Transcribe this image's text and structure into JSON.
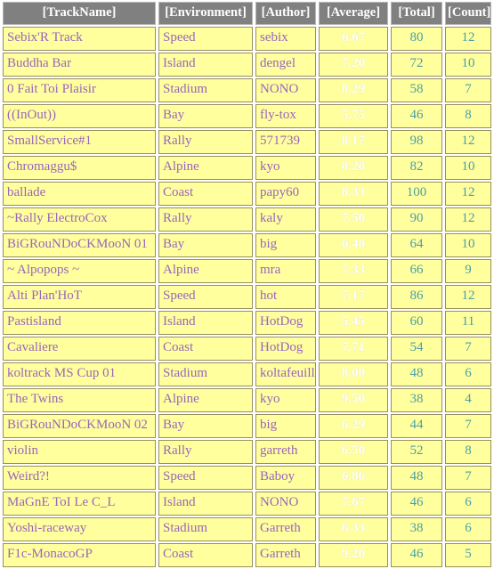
{
  "table": {
    "columns": [
      {
        "key": "track_name",
        "label": "[TrackName]",
        "cls": "c-name"
      },
      {
        "key": "environment",
        "label": "[Environment]",
        "cls": "c-env"
      },
      {
        "key": "author",
        "label": "[Author]",
        "cls": "c-author"
      },
      {
        "key": "average",
        "label": "[Average]",
        "cls": "c-avg"
      },
      {
        "key": "total",
        "label": "[Total]",
        "cls": "c-total"
      },
      {
        "key": "count",
        "label": "[Count]",
        "cls": "c-count"
      }
    ],
    "colors": {
      "header_bg": "#808080",
      "header_text": "#ffffff",
      "cell_bg": "#ffff9e",
      "cell_border": "#998f5c",
      "text_violet": "#9966bb",
      "text_teal": "#4a9fa8",
      "average_good": "#00dd00",
      "average_warn": "#f08000",
      "average_text": "#ffffff"
    },
    "rows": [
      {
        "track_name": "Sebix'R Track",
        "environment": "Speed",
        "author": "sebix",
        "average": "6.67",
        "avg_state": "good",
        "total": "80",
        "count": "12"
      },
      {
        "track_name": "Buddha Bar",
        "environment": "Island",
        "author": "dengel",
        "average": "7.20",
        "avg_state": "good",
        "total": "72",
        "count": "10"
      },
      {
        "track_name": "0 Fait Toi Plaisir",
        "environment": "Stadium",
        "author": "NONO",
        "average": "8.29",
        "avg_state": "good",
        "total": "58",
        "count": "7"
      },
      {
        "track_name": "((InOut))",
        "environment": "Bay",
        "author": "fly-tox",
        "average": "5.75",
        "avg_state": "warn",
        "total": "46",
        "count": "8"
      },
      {
        "track_name": "SmallService#1",
        "environment": "Rally",
        "author": "571739",
        "average": "8.17",
        "avg_state": "good",
        "total": "98",
        "count": "12"
      },
      {
        "track_name": "Chromaggu$",
        "environment": "Alpine",
        "author": "kyo",
        "average": "8.20",
        "avg_state": "good",
        "total": "82",
        "count": "10"
      },
      {
        "track_name": "ballade",
        "environment": "Coast",
        "author": "papy60",
        "average": "8.33",
        "avg_state": "good",
        "total": "100",
        "count": "12"
      },
      {
        "track_name": "~Rally ElectroCox",
        "environment": "Rally",
        "author": "kaly",
        "average": "7.50",
        "avg_state": "good",
        "total": "90",
        "count": "12"
      },
      {
        "track_name": "BiGRouNDoCKMooN 01",
        "environment": "Bay",
        "author": "big",
        "average": "6.40",
        "avg_state": "good",
        "total": "64",
        "count": "10"
      },
      {
        "track_name": "~ Alpopops ~",
        "environment": "Alpine",
        "author": "mra",
        "average": "7.33",
        "avg_state": "good",
        "total": "66",
        "count": "9"
      },
      {
        "track_name": "Alti Plan'HoT",
        "environment": "Speed",
        "author": "hot",
        "average": "7.17",
        "avg_state": "good",
        "total": "86",
        "count": "12"
      },
      {
        "track_name": "Pastisland",
        "environment": "Island",
        "author": "HotDog",
        "average": "5.45",
        "avg_state": "warn",
        "total": "60",
        "count": "11"
      },
      {
        "track_name": "Cavaliere",
        "environment": "Coast",
        "author": "HotDog",
        "average": "7.71",
        "avg_state": "good",
        "total": "54",
        "count": "7"
      },
      {
        "track_name": "koltrack MS Cup 01",
        "environment": "Stadium",
        "author": "koltafeuille",
        "average": "8.00",
        "avg_state": "good",
        "total": "48",
        "count": "6"
      },
      {
        "track_name": "The Twins",
        "environment": "Alpine",
        "author": "kyo",
        "average": "9.50",
        "avg_state": "good",
        "total": "38",
        "count": "4"
      },
      {
        "track_name": "BiGRouNDoCKMooN 02",
        "environment": "Bay",
        "author": "big",
        "average": "6.29",
        "avg_state": "good",
        "total": "44",
        "count": "7"
      },
      {
        "track_name": "violin",
        "environment": "Rally",
        "author": "garreth",
        "average": "6.50",
        "avg_state": "good",
        "total": "52",
        "count": "8"
      },
      {
        "track_name": "Weird?!",
        "environment": "Speed",
        "author": "Baboy",
        "average": "6.86",
        "avg_state": "good",
        "total": "48",
        "count": "7"
      },
      {
        "track_name": "MaGnE ToI Le C_L",
        "environment": "Island",
        "author": "NONO",
        "average": "7.67",
        "avg_state": "good",
        "total": "46",
        "count": "6"
      },
      {
        "track_name": "Yoshi-raceway",
        "environment": "Stadium",
        "author": "Garreth",
        "average": "6.33",
        "avg_state": "good",
        "total": "38",
        "count": "6"
      },
      {
        "track_name": "F1c-MonacoGP",
        "environment": "Coast",
        "author": "Garreth",
        "average": "9.20",
        "avg_state": "good",
        "total": "46",
        "count": "5"
      }
    ]
  }
}
